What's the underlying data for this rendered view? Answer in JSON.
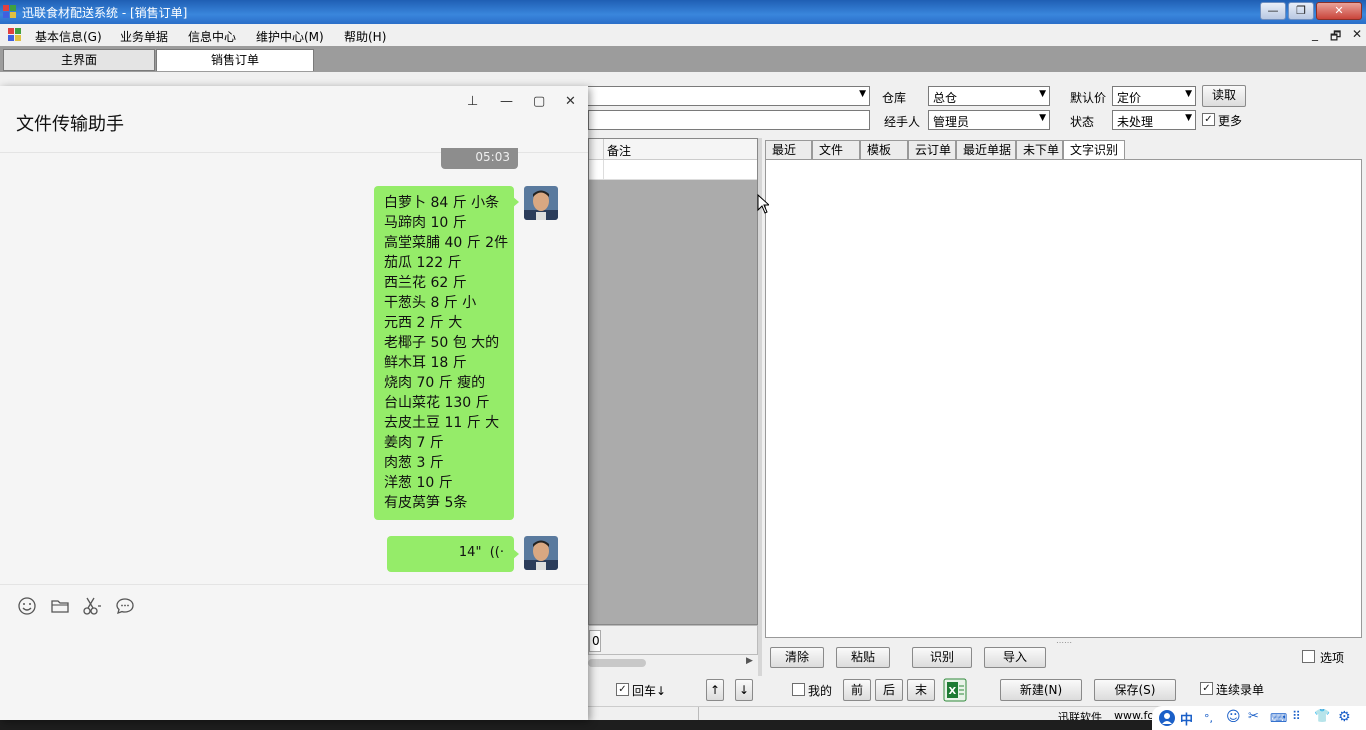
{
  "window": {
    "title": "迅联食材配送系统 - [销售订单]",
    "controls": [
      "—",
      "❐",
      "✕"
    ]
  },
  "menu": [
    "基本信息(G)",
    "业务单据",
    "信息中心",
    "维护中心(M)",
    "帮助(H)"
  ],
  "mdi_controls": [
    "_",
    "🗗",
    "✕"
  ],
  "tabs": [
    {
      "label": "主界面",
      "active": false
    },
    {
      "label": "销售订单",
      "active": true
    }
  ],
  "form": {
    "warehouse_label": "仓库",
    "warehouse_value": "总仓",
    "default_price_label": "默认价",
    "default_price_value": "定价",
    "read_button": "读取",
    "handler_label": "经手人",
    "handler_value": "管理员",
    "status_label": "状态",
    "status_value": "未处理",
    "more_label": "更多",
    "more_checked": true
  },
  "grid": {
    "headers": [
      "备注"
    ],
    "footer_value": "0"
  },
  "right_tabs": [
    {
      "label": "最近",
      "active": false
    },
    {
      "label": "文件",
      "active": false
    },
    {
      "label": "模板",
      "active": false
    },
    {
      "label": "云订单",
      "active": false
    },
    {
      "label": "最近单据",
      "active": false
    },
    {
      "label": "未下单",
      "active": false
    },
    {
      "label": "文字识别",
      "active": true
    }
  ],
  "right_buttons": {
    "clear": "清除",
    "paste": "粘贴",
    "recognize": "识别",
    "import": "导入",
    "options_label": "选项",
    "options_checked": false
  },
  "bottom_bar": {
    "enter_down_label": "回车↓",
    "enter_down_checked": true,
    "up": "↑",
    "down": "↓",
    "mine_label": "我的",
    "mine_checked": false,
    "prev": "前",
    "next": "后",
    "last": "末",
    "new": "新建(N)",
    "save": "保存(S)",
    "continuous_label": "连续录单",
    "continuous_checked": true
  },
  "status_bar": {
    "company": "迅联软件",
    "url_fragment": "www.fo"
  },
  "chat": {
    "title": "文件传输助手",
    "window_buttons": [
      "⊥",
      "—",
      "▢",
      "✕"
    ],
    "earlier_voice_duration": "05:03",
    "message_lines": [
      "白萝卜 84 斤 小条",
      "马蹄肉 10 斤",
      "高堂菜脯 40 斤 2件",
      "茄瓜 122 斤",
      "西兰花 62 斤",
      "干葱头 8 斤 小",
      "元西 2 斤 大",
      "老椰子 50 包 大的",
      "鲜木耳 18 斤",
      "烧肉 70 斤 瘦的",
      "台山菜花 130 斤",
      "去皮土豆 11 斤 大",
      "姜肉 7 斤",
      "肉葱 3 斤",
      "洋葱 10 斤",
      "有皮莴笋   5条"
    ],
    "voice_duration": "14\"",
    "input_tools": [
      "emoji-icon",
      "folder-icon",
      "scissors-icon",
      "chat-bubble-icon"
    ]
  },
  "tray": {
    "ime_label": "中"
  }
}
